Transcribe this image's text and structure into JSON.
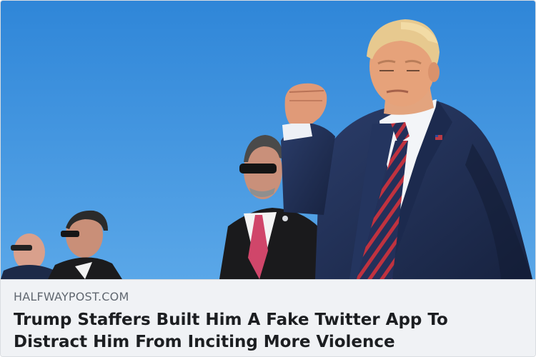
{
  "link_preview": {
    "domain": "HALFWAYPOST.COM",
    "headline": "Trump Staffers Built Him A Fake Twitter App To Distract Him From Inciting More Violence",
    "image_description_icon": "photo-image"
  },
  "colors": {
    "sky": "#3c91dd",
    "meta_background": "#f0f2f5",
    "domain_text": "#606770",
    "headline_text": "#1c1e21",
    "suit_navy": "#1f2f55",
    "tie_red": "#b3263a"
  }
}
